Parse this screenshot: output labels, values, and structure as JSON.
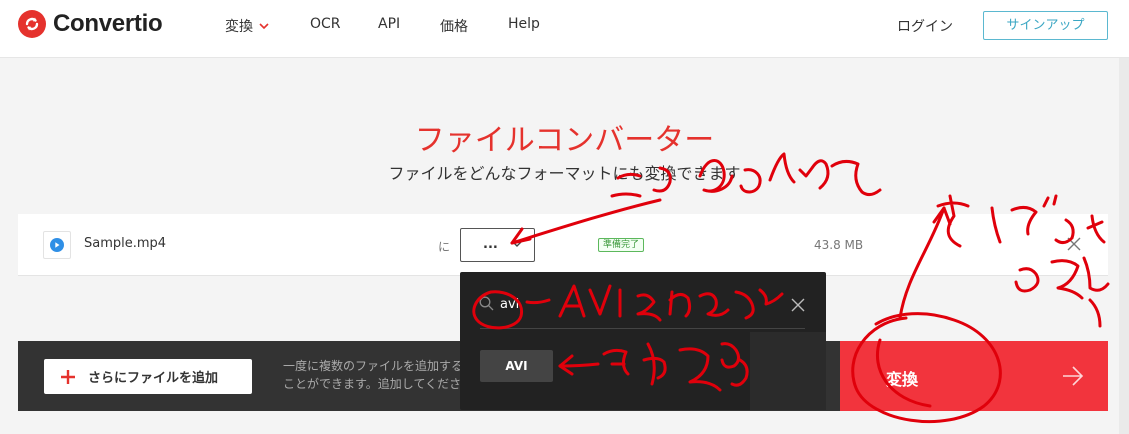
{
  "brand": {
    "name": "Convertio",
    "color": "#e5322d"
  },
  "nav": {
    "items": [
      {
        "label": "変換",
        "has_dropdown": true
      },
      {
        "label": "OCR"
      },
      {
        "label": "API"
      },
      {
        "label": "価格"
      },
      {
        "label": "Help"
      }
    ],
    "login": "ログイン",
    "signup": "サインアップ"
  },
  "hero": {
    "title": "ファイルコンバーター",
    "subtitle": "ファイルをどんなフォーマットにも変換できます"
  },
  "file": {
    "name": "Sample.mp4",
    "to_label": "に",
    "format_value": "...",
    "status": "準備完了",
    "size": "43.8 MB"
  },
  "actions": {
    "add_label": "さらにファイルを追加",
    "add_hint": "一度に複数のファイルを追加することができます。追加してください",
    "convert_label": "変換"
  },
  "format_dropdown": {
    "search_value": "avi",
    "options": [
      "AVI"
    ]
  },
  "colors": {
    "accent": "#f2343d",
    "dark_bar": "#333333",
    "dropdown_bg": "#222222",
    "ink": "#e0000b"
  }
}
